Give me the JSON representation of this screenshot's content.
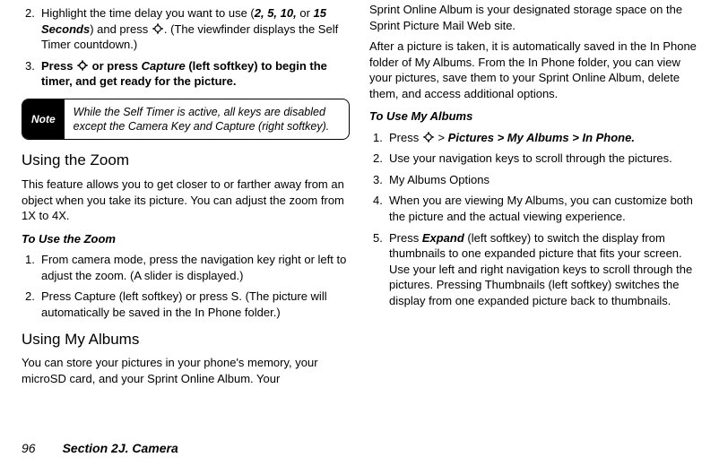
{
  "footer": {
    "page_number": "96",
    "section_label": "Section 2J. Camera"
  },
  "left": {
    "item2_pre": "Highlight the time delay you want to use (",
    "delay_opts": "2, 5, 10,",
    "delay_or": " or ",
    "delay_last": "15 Seconds",
    "item2_mid": ") and press ",
    "item2_post": ". (The viewfinder displays the Self Timer countdown.)",
    "item3_a": "Press ",
    "item3_b": " or press ",
    "item3_c": "Capture",
    "item3_d": " (left softkey) to begin the timer, and get ready for the picture.",
    "note_label": "Note",
    "note_body": "While the Self Timer is active, all keys are disabled except the Camera Key and Capture (right softkey).",
    "zoom_heading": "Using the Zoom",
    "zoom_para": "This feature allows you to get closer to or farther away from an object when you take its picture. You can adjust the zoom from 1X to 4X.",
    "zoom_sub": "To Use  the Zoom",
    "zoom_s1": "From camera mode, press the navigation key right or left to adjust the zoom. (A slider is displayed.)",
    "zoom_s2": "Press Capture (left softkey) or press S. (The picture will automatically be saved in the In Phone folder.)",
    "albums_heading": "Using My Albums",
    "albums_para": "You can store your pictures in your phone's memory, your microSD card, and your Sprint Online Album. Your "
  },
  "right": {
    "cont_para1": "Sprint Online Album is your designated storage space on the Sprint Picture Mail Web site.",
    "cont_para2": "After a picture is taken, it is automatically saved in the In Phone folder of My Albums. From the In Phone folder, you can view your pictures, save them to your Sprint Online Album, delete them, and access additional options.",
    "albums_sub": "To Use My Albums",
    "step1_a": "Press ",
    "step1_b": " > ",
    "step1_c": "Pictures > My Albums > In Phone.",
    "step2": "Use your navigation keys to scroll through the pictures.",
    "step3": "My Albums Options",
    "step4": "When you are viewing My Albums, you can customize both the picture and the actual viewing experience.",
    "step5_a": "Press ",
    "step5_b": "Expand",
    "step5_c": " (left softkey) to switch the display from thumbnails to one expanded picture that fits your screen. Use your left and right navigation keys to scroll through the pictures. Pressing Thumbnails (left softkey) switches the display from one expanded picture back to thumbnails."
  },
  "nums": {
    "n1": "1.",
    "n2": "2.",
    "n3": "3.",
    "n4": "4.",
    "n5": "5."
  }
}
